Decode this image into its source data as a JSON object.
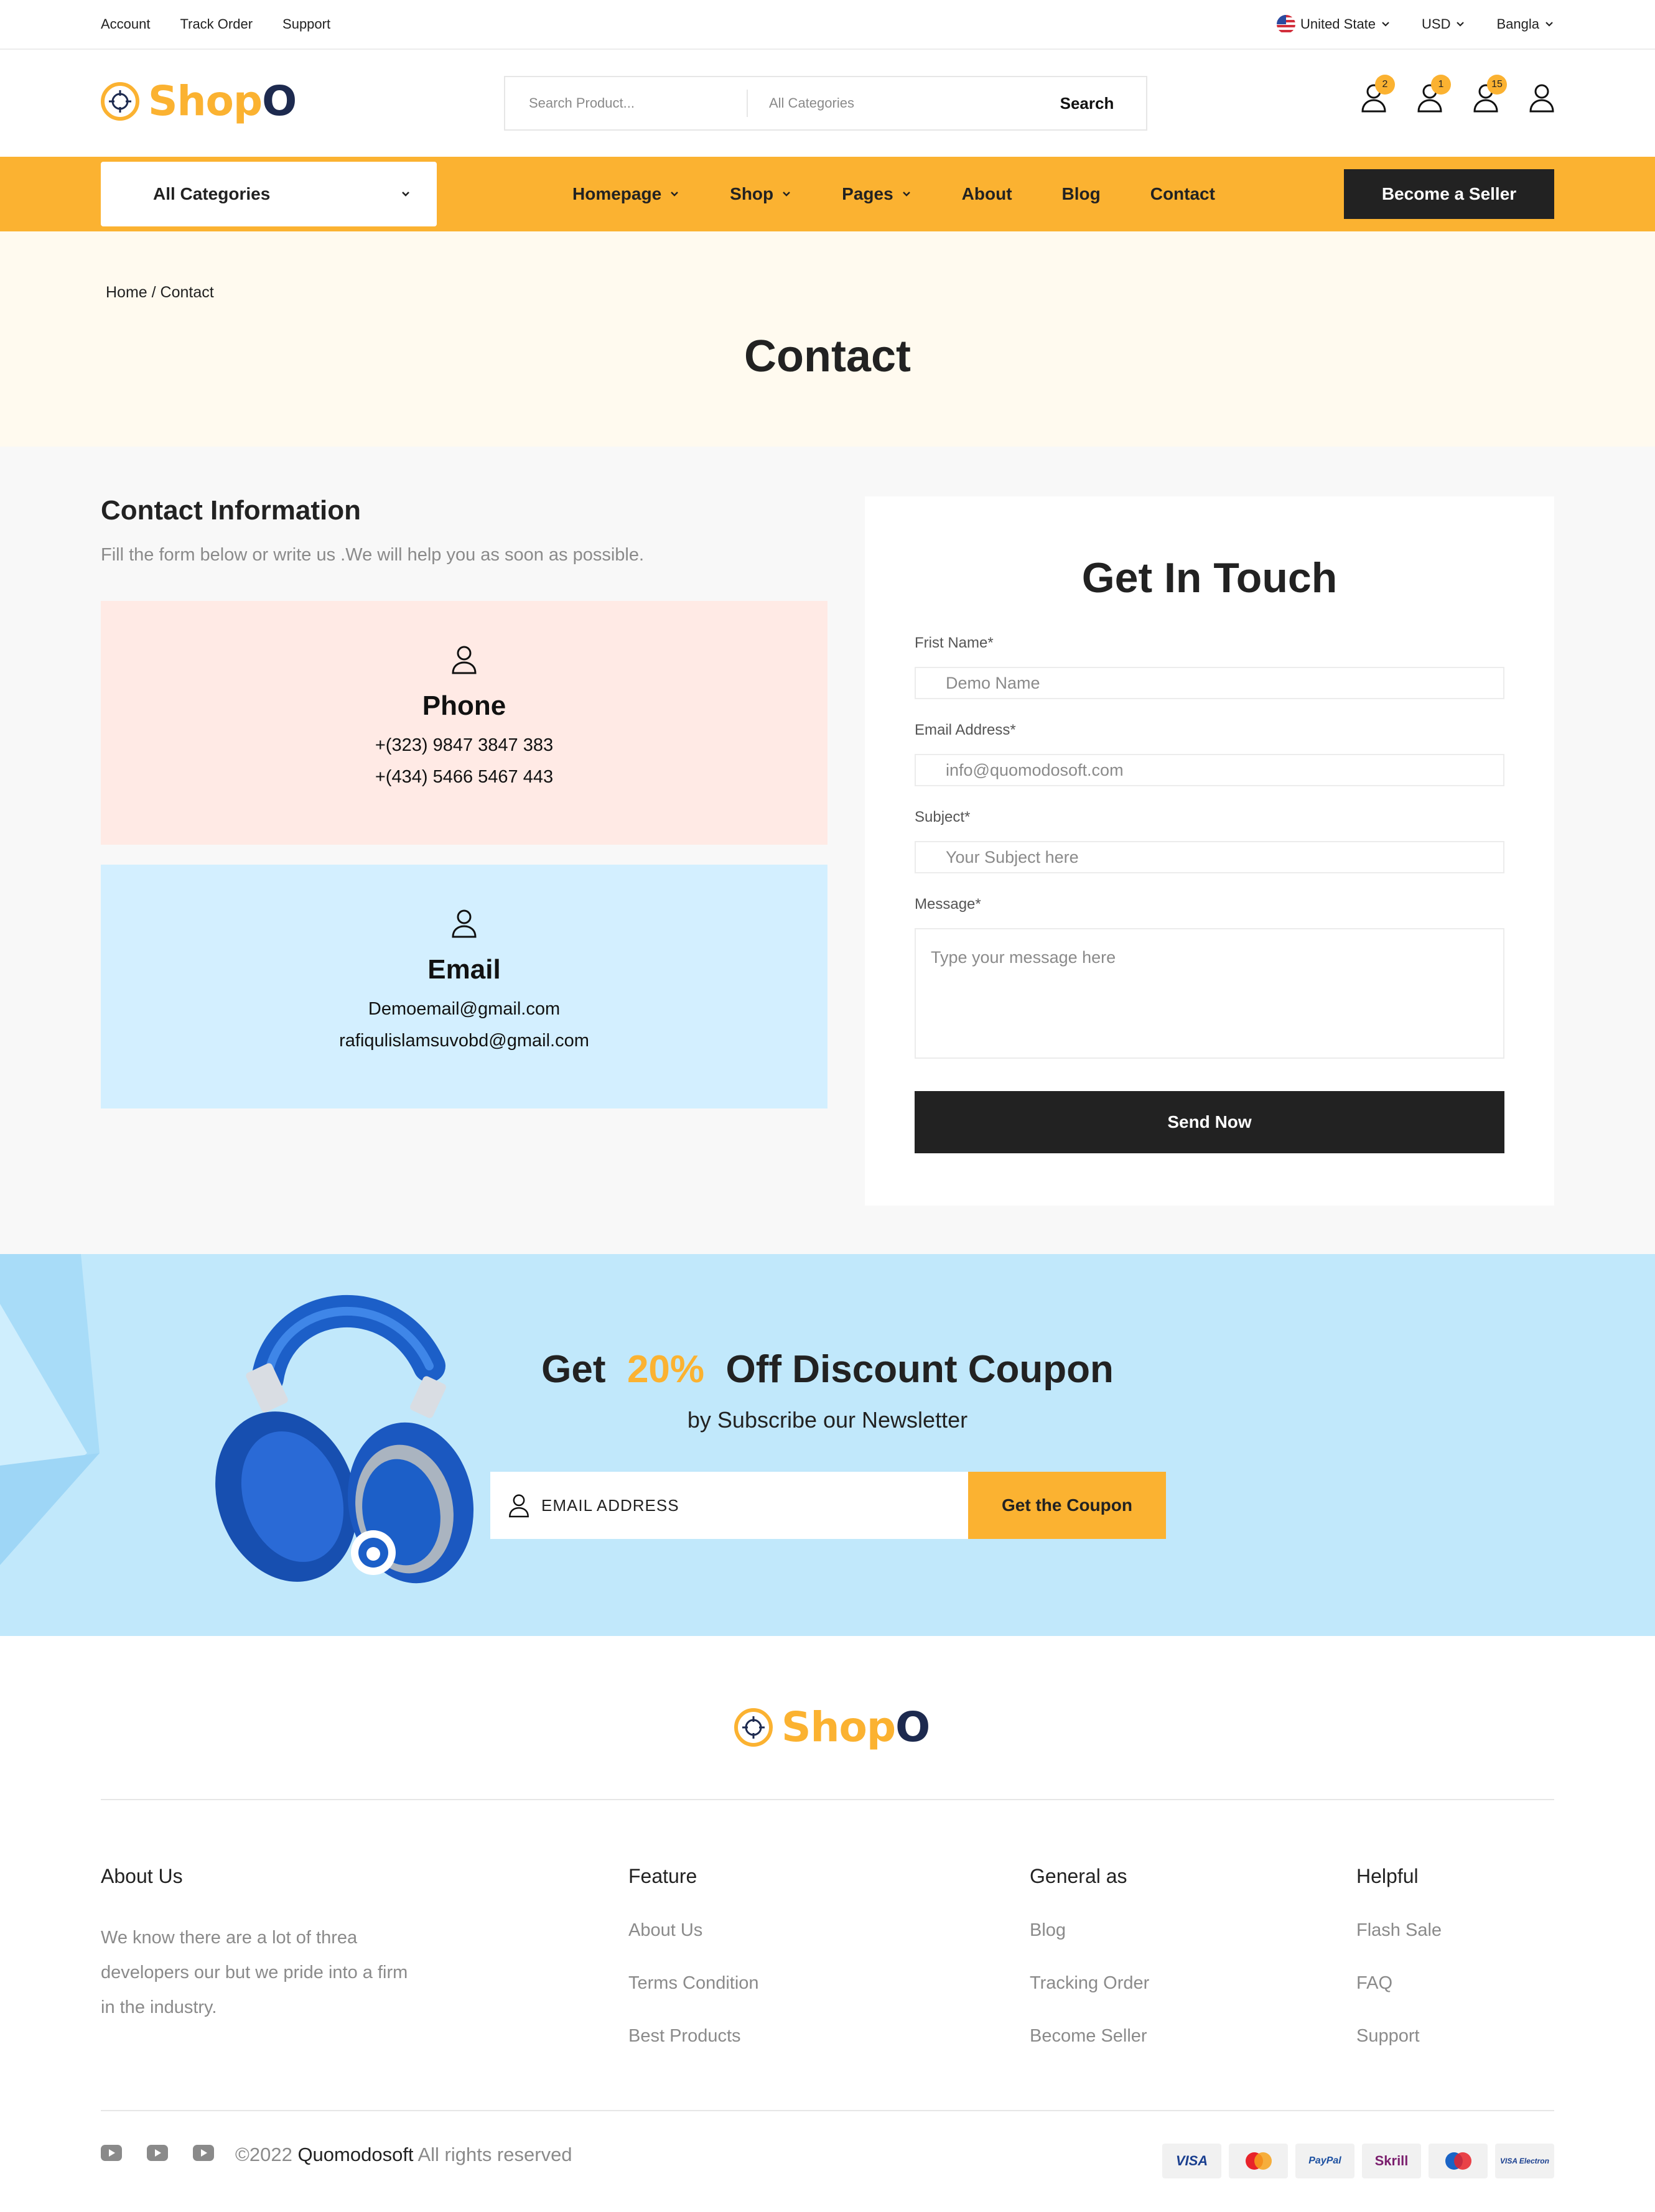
{
  "topbar": {
    "links": [
      "Account",
      "Track Order",
      "Support"
    ],
    "country": "United State",
    "currency": "USD",
    "language": "Bangla"
  },
  "header": {
    "logo": {
      "part1": "Shop",
      "part2": "O"
    },
    "search": {
      "placeholder": "Search Product...",
      "category": "All Categories",
      "button": "Search"
    },
    "icons": [
      {
        "name": "compare-icon",
        "badge": "2"
      },
      {
        "name": "wishlist-icon",
        "badge": "1"
      },
      {
        "name": "cart-icon",
        "badge": "15"
      },
      {
        "name": "user-icon",
        "badge": ""
      }
    ]
  },
  "nav": {
    "all_categories": "All Categories",
    "items": [
      {
        "label": "Homepage",
        "dropdown": true
      },
      {
        "label": "Shop",
        "dropdown": true
      },
      {
        "label": "Pages",
        "dropdown": true
      },
      {
        "label": "About",
        "dropdown": false
      },
      {
        "label": "Blog",
        "dropdown": false
      },
      {
        "label": "Contact",
        "dropdown": false
      }
    ],
    "seller_button": "Become a Seller"
  },
  "hero": {
    "breadcrumb": {
      "home": "Home",
      "sep": "/",
      "current": "Contact"
    },
    "title": "Contact"
  },
  "contact_info": {
    "title": "Contact Information",
    "subtitle": "Fill the form below or write us .We will help you as soon as possible.",
    "phone": {
      "title": "Phone",
      "lines": [
        "+(323) 9847 3847 383",
        "+(434) 5466 5467 443"
      ]
    },
    "email": {
      "title": "Email",
      "lines": [
        "Demoemail@gmail.com",
        "rafiqulislamsuvobd@gmail.com"
      ]
    }
  },
  "form": {
    "title": "Get In Touch",
    "first_name": {
      "label": "Frist Name*",
      "placeholder": "Demo Name"
    },
    "email": {
      "label": "Email Address*",
      "placeholder": "info@quomodosoft.com"
    },
    "subject": {
      "label": "Subject*",
      "placeholder": "Your Subject here"
    },
    "message": {
      "label": "Message*",
      "placeholder": "Type your message here"
    },
    "submit": "Send Now"
  },
  "newsletter": {
    "title_pre": "Get",
    "title_percent": "20%",
    "title_post": "Off Discount Coupon",
    "subtitle": "by Subscribe our Newsletter",
    "email_placeholder": "EMAIL ADDRESS",
    "button": "Get the Coupon"
  },
  "footer": {
    "about": {
      "title": "About Us",
      "text": "We know there are a lot of threa developers our but we pride into a firm in the industry."
    },
    "columns": [
      {
        "title": "Feature",
        "links": [
          "About Us",
          "Terms Condition",
          "Best Products"
        ]
      },
      {
        "title": "General as",
        "links": [
          "Blog",
          "Tracking Order",
          "Become Seller"
        ]
      },
      {
        "title": "Helpful",
        "links": [
          "Flash Sale",
          "FAQ",
          "Support"
        ]
      }
    ],
    "copyright_pre": "©2022",
    "copyright_company": "Quomodosoft",
    "copyright_post": "All rights reserved",
    "payments": [
      "VISA",
      "Mastercard",
      "PayPal",
      "Skrill",
      "Maestro",
      "VISA Electron"
    ]
  },
  "colors": {
    "accent": "#FBB231",
    "dark": "#222222",
    "phone_card": "#FFEAE5",
    "email_card": "#D3EFFF",
    "newsletter_bg": "#C1E8FB"
  }
}
